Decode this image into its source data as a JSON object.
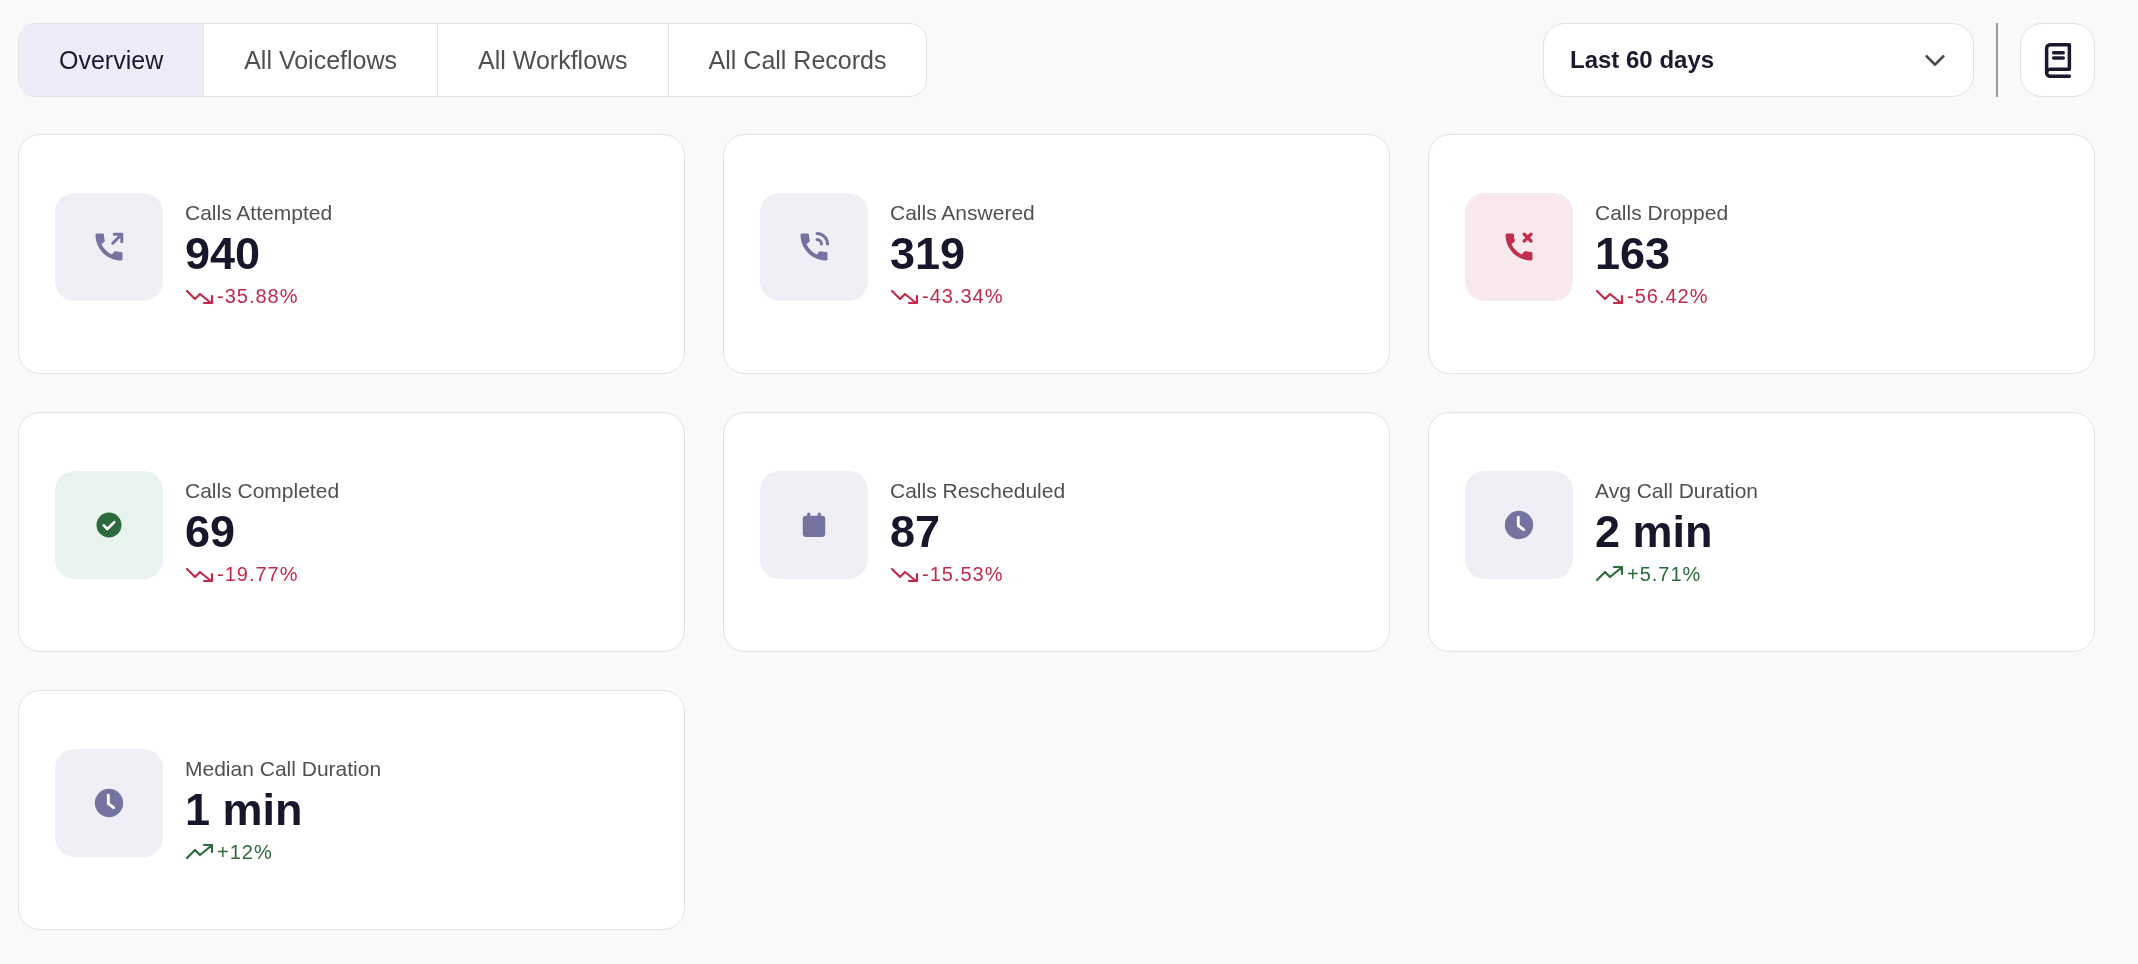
{
  "tabs": [
    {
      "label": "Overview",
      "selected": true
    },
    {
      "label": "All Voiceflows",
      "selected": false
    },
    {
      "label": "All Workflows",
      "selected": false
    },
    {
      "label": "All Call Records",
      "selected": false
    }
  ],
  "date_range": {
    "value": "Last 60 days"
  },
  "metrics": [
    {
      "kind": "outgoing",
      "title": "Calls Attempted",
      "value": "940",
      "change": "-35.88%",
      "rising": false
    },
    {
      "kind": "answered",
      "title": "Calls Answered",
      "value": "319",
      "change": "-43.34%",
      "rising": false
    },
    {
      "kind": "dropped",
      "title": "Calls Dropped",
      "value": "163",
      "change": "-56.42%",
      "rising": false
    },
    {
      "kind": "completed",
      "title": "Calls Completed",
      "value": "69",
      "change": "-19.77%",
      "rising": false
    },
    {
      "kind": "rescheduled",
      "title": "Calls Rescheduled",
      "value": "87",
      "change": "-15.53%",
      "rising": false
    },
    {
      "kind": "duration",
      "title": "Avg Call Duration",
      "value": "2 min",
      "change": "+5.71%",
      "rising": true
    },
    {
      "kind": "duration",
      "title": "Median Call Duration",
      "value": "1 min",
      "change": "+12%",
      "rising": true
    }
  ]
}
